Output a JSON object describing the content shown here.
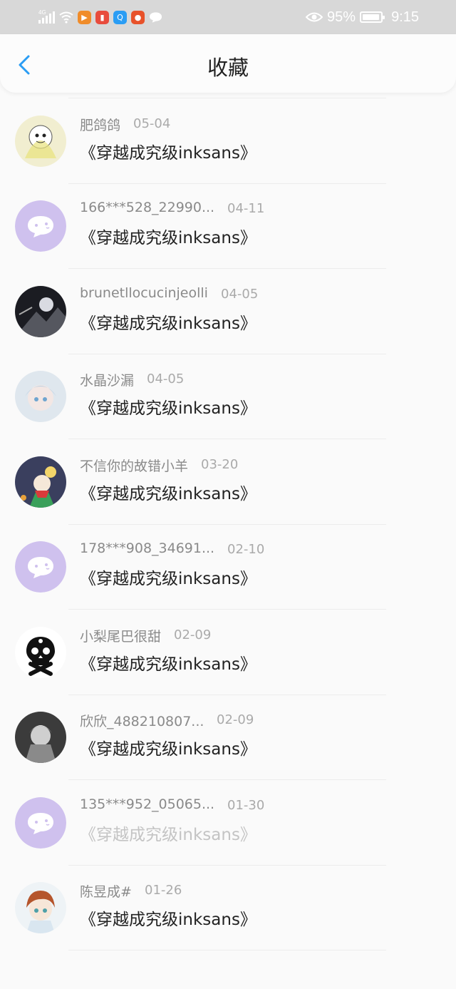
{
  "status_bar": {
    "network": "4G",
    "battery_percent": "95%",
    "battery_level": 0.95,
    "time": "9:15",
    "app_icons": [
      {
        "name": "video-app-icon",
        "color": "#f08c2a"
      },
      {
        "name": "book-app-icon",
        "color": "#e84c3d"
      },
      {
        "name": "search-app-icon",
        "color": "#2a9df4"
      },
      {
        "name": "sun-app-icon",
        "color": "#e8522a"
      },
      {
        "name": "chat-app-icon",
        "color": "#ffffff"
      }
    ]
  },
  "header": {
    "title": "收藏",
    "back_icon": "chevron-left-icon",
    "accent_color": "#2a9df4"
  },
  "items": [
    {
      "user": "",
      "date": "",
      "title": "《穿越成究级inksans》",
      "avatar": "photo-dark",
      "faded": false
    },
    {
      "user": "肥鸽鸽",
      "date": "05-04",
      "title": "《穿越成究级inksans》",
      "avatar": "anime-yellow",
      "faded": false
    },
    {
      "user": "166***528_22990...",
      "date": "04-11",
      "title": "《穿越成究级inksans》",
      "avatar": "default-chat",
      "faded": false
    },
    {
      "user": "brunetllocucinjeolli",
      "date": "04-05",
      "title": "《穿越成究级inksans》",
      "avatar": "photo-night",
      "faded": false
    },
    {
      "user": "水晶沙漏",
      "date": "04-05",
      "title": "《穿越成究级inksans》",
      "avatar": "anime-blue",
      "faded": false
    },
    {
      "user": "不信你的故错小羊",
      "date": "03-20",
      "title": "《穿越成究级inksans》",
      "avatar": "anime-colorful",
      "faded": false
    },
    {
      "user": "178***908_34691...",
      "date": "02-10",
      "title": "《穿越成究级inksans》",
      "avatar": "default-chat",
      "faded": false
    },
    {
      "user": "小梨尾巴很甜",
      "date": "02-09",
      "title": "《穿越成究级inksans》",
      "avatar": "skull",
      "faded": false
    },
    {
      "user": "欣欣_488210807...",
      "date": "02-09",
      "title": "《穿越成究级inksans》",
      "avatar": "anime-gray",
      "faded": false
    },
    {
      "user": "135***952_05065...",
      "date": "01-30",
      "title": "《穿越成究级inksans》",
      "avatar": "default-chat",
      "faded": true
    },
    {
      "user": "陈昱成#",
      "date": "01-26",
      "title": "《穿越成究级inksans》",
      "avatar": "anime-boy",
      "faded": false
    }
  ]
}
